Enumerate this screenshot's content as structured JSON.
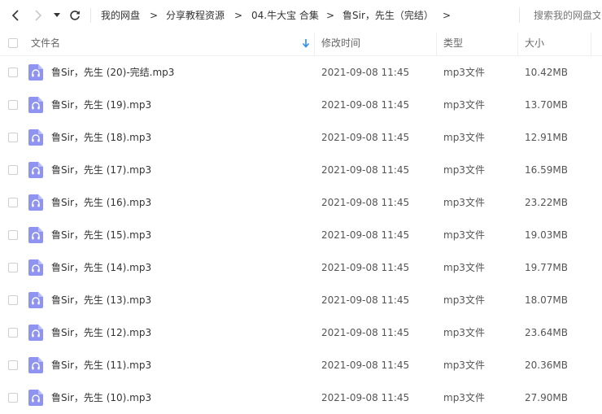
{
  "toolbar": {
    "breadcrumbs": [
      "我的网盘",
      "分享教程资源",
      "04.牛大宝 合集",
      "鲁Sir，先生（完结）"
    ],
    "separator": ">",
    "search_placeholder": "搜索我的网盘文件"
  },
  "columns": {
    "name": "文件名",
    "modified": "修改时间",
    "type": "类型",
    "size": "大小"
  },
  "files": [
    {
      "name": "鲁Sir，先生 (20)-完结.mp3",
      "modified": "2021-09-08 11:45",
      "type": "mp3文件",
      "size": "10.42MB"
    },
    {
      "name": "鲁Sir，先生 (19).mp3",
      "modified": "2021-09-08 11:45",
      "type": "mp3文件",
      "size": "13.70MB"
    },
    {
      "name": "鲁Sir，先生 (18).mp3",
      "modified": "2021-09-08 11:45",
      "type": "mp3文件",
      "size": "12.91MB"
    },
    {
      "name": "鲁Sir，先生 (17).mp3",
      "modified": "2021-09-08 11:45",
      "type": "mp3文件",
      "size": "16.59MB"
    },
    {
      "name": "鲁Sir，先生 (16).mp3",
      "modified": "2021-09-08 11:45",
      "type": "mp3文件",
      "size": "23.22MB"
    },
    {
      "name": "鲁Sir，先生 (15).mp3",
      "modified": "2021-09-08 11:45",
      "type": "mp3文件",
      "size": "19.03MB"
    },
    {
      "name": "鲁Sir，先生 (14).mp3",
      "modified": "2021-09-08 11:45",
      "type": "mp3文件",
      "size": "19.77MB"
    },
    {
      "name": "鲁Sir，先生 (13).mp3",
      "modified": "2021-09-08 11:45",
      "type": "mp3文件",
      "size": "18.07MB"
    },
    {
      "name": "鲁Sir，先生 (12).mp3",
      "modified": "2021-09-08 11:45",
      "type": "mp3文件",
      "size": "23.64MB"
    },
    {
      "name": "鲁Sir，先生 (11).mp3",
      "modified": "2021-09-08 11:45",
      "type": "mp3文件",
      "size": "20.36MB"
    },
    {
      "name": "鲁Sir，先生 (10).mp3",
      "modified": "2021-09-08 11:45",
      "type": "mp3文件",
      "size": "27.90MB"
    }
  ],
  "icons": {
    "back": "chevron-left-icon",
    "forward": "chevron-right-icon",
    "history": "caret-down-icon",
    "refresh": "refresh-icon",
    "sort": "arrow-down-icon",
    "file": "audio-file-icon"
  },
  "colors": {
    "accent": "#2b8ef0",
    "file_icon": "#8f93f2"
  }
}
